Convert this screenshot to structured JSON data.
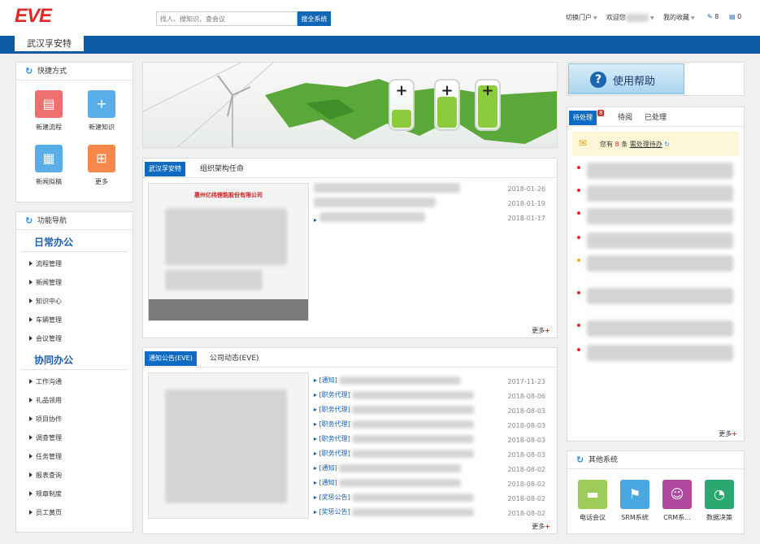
{
  "header": {
    "logo": "EVE",
    "search_placeholder": "找人、搜知识、查会议",
    "search_button": "搜全系统",
    "switch_portal": "切换门户",
    "welcome": "欢迎您",
    "favorites": "我的收藏",
    "edit_count": "8",
    "doc_count": "0"
  },
  "nav": {
    "active_tab": "武汉孚安特"
  },
  "quick": {
    "title": "快捷方式",
    "items": [
      {
        "label": "新建流程",
        "color": "#f07070",
        "icon": "document-icon"
      },
      {
        "label": "新建知识",
        "color": "#5aaee8",
        "icon": "knowledge-icon"
      },
      {
        "label": "新闻拟稿",
        "color": "#5aaee8",
        "icon": "news-icon"
      },
      {
        "label": "更多",
        "color": "#f5884a",
        "icon": "grid-icon"
      }
    ]
  },
  "funcnav": {
    "title": "功能导航",
    "sections": [
      {
        "title": "日常办公",
        "items": [
          "流程管理",
          "新闻管理",
          "知识中心",
          "车辆管理",
          "会议管理"
        ]
      },
      {
        "title": "协同办公",
        "items": [
          "工作沟通",
          "礼品领用",
          "项目协作",
          "调查管理",
          "任务管理",
          "报表查询",
          "规章制度",
          "员工黄页"
        ]
      }
    ]
  },
  "org": {
    "tabs": [
      "武汉孚安特",
      "组织架构任命"
    ],
    "thumb_caption": "惠州亿纬锂能股份有限公司",
    "dates": [
      "2018-01-26",
      "2018-01-19",
      "2018-01-17"
    ],
    "more": "更多"
  },
  "notice": {
    "tabs": [
      "通知公告(EVE)",
      "公司动态(EVE)"
    ],
    "items": [
      {
        "tag": "[通知]",
        "date": "2017-11-23"
      },
      {
        "tag": "[职务代理]",
        "date": "2018-08-06"
      },
      {
        "tag": "[职务代理]",
        "date": "2018-08-03"
      },
      {
        "tag": "[职务代理]",
        "date": "2018-08-03"
      },
      {
        "tag": "[职务代理]",
        "date": "2018-08-03"
      },
      {
        "tag": "[职务代理]",
        "date": "2018-08-03"
      },
      {
        "tag": "[通知]",
        "date": "2018-08-02"
      },
      {
        "tag": "[通知]",
        "date": "2018-08-02"
      },
      {
        "tag": "[奖惩公告]",
        "date": "2018-08-02"
      },
      {
        "tag": "[奖惩公告]",
        "date": "2018-08-02"
      }
    ],
    "more": "更多"
  },
  "help": {
    "label": "使用帮助"
  },
  "todo": {
    "tabs": [
      "待处理",
      "待阅",
      "已处理"
    ],
    "badge": "8",
    "summary_pre": "您有",
    "summary_count": "8",
    "summary_mid": "条",
    "summary_link": "需处理待办",
    "more": "更多"
  },
  "others": {
    "title": "其他系统",
    "items": [
      {
        "label": "电话会议",
        "color": "#9dcc5a",
        "icon": "chat-icon"
      },
      {
        "label": "SRM系统",
        "color": "#4aa8e0",
        "icon": "srm-icon"
      },
      {
        "label": "CRM系...",
        "color": "#b04aa0",
        "icon": "users-icon"
      },
      {
        "label": "数据决策",
        "color": "#2aa870",
        "icon": "chart-icon"
      }
    ]
  }
}
